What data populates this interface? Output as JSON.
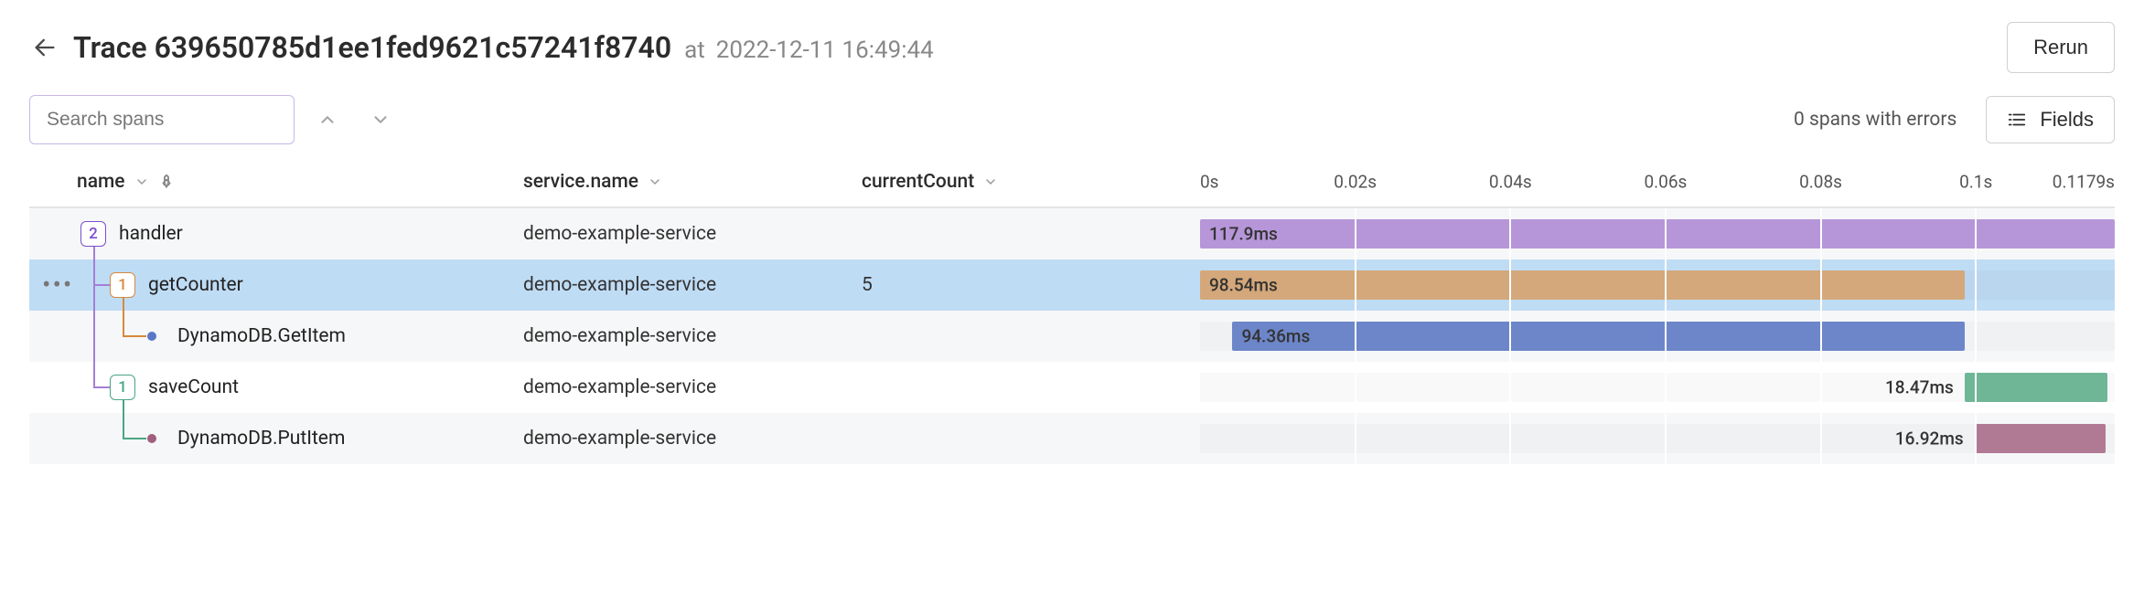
{
  "header": {
    "title_prefix": "Trace",
    "trace_id": "639650785d1ee1fed9621c57241f8740",
    "at_label": "at",
    "timestamp": "2022-12-11 16:49:44",
    "rerun_label": "Rerun"
  },
  "toolbar": {
    "search_placeholder": "Search spans",
    "errors_text": "0 spans with errors",
    "fields_label": "Fields"
  },
  "columns": {
    "name_label": "name",
    "service_label": "service.name",
    "extra_label": "currentCount"
  },
  "timeline": {
    "min": 0,
    "max": 0.1179,
    "ticks": [
      {
        "pos": 0,
        "label": "0s"
      },
      {
        "pos": 0.02,
        "label": "0.02s"
      },
      {
        "pos": 0.04,
        "label": "0.04s"
      },
      {
        "pos": 0.06,
        "label": "0.06s"
      },
      {
        "pos": 0.08,
        "label": "0.08s"
      },
      {
        "pos": 0.1,
        "label": "0.1s"
      },
      {
        "pos": 0.1179,
        "label": "0.1179s"
      }
    ]
  },
  "rows": [
    {
      "name": "handler",
      "service": "demo-example-service",
      "extra": "",
      "children_count": "2",
      "badge_color": "purple",
      "indent": 0,
      "selected": false,
      "alt": true,
      "dots": false,
      "is_leaf": false,
      "bar": {
        "start": 0,
        "end": 0.1179,
        "color": "purple",
        "label": "117.9ms",
        "label_inside": true
      }
    },
    {
      "name": "getCounter",
      "service": "demo-example-service",
      "extra": "5",
      "children_count": "1",
      "badge_color": "orange",
      "indent": 1,
      "selected": true,
      "alt": false,
      "dots": true,
      "is_leaf": false,
      "bar": {
        "start": 0,
        "end": 0.09854,
        "color": "tan",
        "label": "98.54ms",
        "label_inside": true
      }
    },
    {
      "name": "DynamoDB.GetItem",
      "service": "demo-example-service",
      "extra": "",
      "children_count": "",
      "badge_color": "",
      "indent": 2,
      "selected": false,
      "alt": true,
      "dots": false,
      "is_leaf": true,
      "leaf_color": "blue",
      "bar": {
        "start": 0.00418,
        "end": 0.09854,
        "color": "blue",
        "label": "94.36ms",
        "label_inside": true
      }
    },
    {
      "name": "saveCount",
      "service": "demo-example-service",
      "extra": "",
      "children_count": "1",
      "badge_color": "green",
      "indent": 1,
      "selected": false,
      "alt": false,
      "dots": false,
      "is_leaf": false,
      "bar": {
        "start": 0.09854,
        "end": 0.11701,
        "color": "teal",
        "label": "18.47ms",
        "label_inside": false
      }
    },
    {
      "name": "DynamoDB.PutItem",
      "service": "demo-example-service",
      "extra": "",
      "children_count": "",
      "badge_color": "",
      "indent": 2,
      "selected": false,
      "alt": true,
      "dots": false,
      "is_leaf": true,
      "leaf_color": "mauve",
      "bar": {
        "start": 0.09982,
        "end": 0.11674,
        "color": "mauve",
        "label": "16.92ms",
        "label_inside": false
      }
    }
  ]
}
